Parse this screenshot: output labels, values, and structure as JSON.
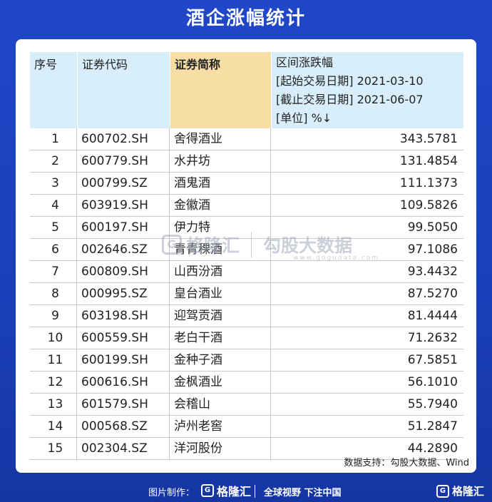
{
  "title": "酒企涨幅统计",
  "table": {
    "headers": {
      "index": "序号",
      "code": "证券代码",
      "name": "证券简称",
      "change_line1": "区间涨跌幅",
      "change_line2": "[起始交易日期] 2021-03-10",
      "change_line3": "[截止交易日期] 2021-06-07",
      "change_line4": "[单位] %↓"
    },
    "rows": [
      {
        "idx": "1",
        "code": "600702.SH",
        "name": "舍得酒业",
        "value": "343.5781"
      },
      {
        "idx": "2",
        "code": "600779.SH",
        "name": "水井坊",
        "value": "131.4854"
      },
      {
        "idx": "3",
        "code": "000799.SZ",
        "name": "酒鬼酒",
        "value": "111.1373"
      },
      {
        "idx": "4",
        "code": "603919.SH",
        "name": "金徽酒",
        "value": "109.5826"
      },
      {
        "idx": "5",
        "code": "600197.SH",
        "name": "伊力特",
        "value": "99.5050"
      },
      {
        "idx": "6",
        "code": "002646.SZ",
        "name": "青青稞酒",
        "value": "97.1086"
      },
      {
        "idx": "7",
        "code": "600809.SH",
        "name": "山西汾酒",
        "value": "93.4432"
      },
      {
        "idx": "8",
        "code": "000995.SZ",
        "name": "皇台酒业",
        "value": "87.5270"
      },
      {
        "idx": "9",
        "code": "603198.SH",
        "name": "迎驾贡酒",
        "value": "81.4444"
      },
      {
        "idx": "10",
        "code": "600559.SH",
        "name": "老白干酒",
        "value": "71.2632"
      },
      {
        "idx": "11",
        "code": "600199.SH",
        "name": "金种子酒",
        "value": "67.5851"
      },
      {
        "idx": "12",
        "code": "600616.SH",
        "name": "金枫酒业",
        "value": "56.1010"
      },
      {
        "idx": "13",
        "code": "601579.SH",
        "name": "会稽山",
        "value": "55.7940"
      },
      {
        "idx": "14",
        "code": "000568.SZ",
        "name": "泸州老窖",
        "value": "51.2847"
      },
      {
        "idx": "15",
        "code": "002304.SZ",
        "name": "洋河股份",
        "value": "44.2890"
      }
    ]
  },
  "watermark": {
    "brand": "格隆汇",
    "divider_text": "勾股大数据",
    "url": "www.gogudata.com"
  },
  "source": "数据支持：勾股大数据、Wind",
  "footer": {
    "made_by_label": "图片制作：",
    "logo_text": "格隆汇",
    "slogan": "全球视野 下注中国",
    "brand_right": "格隆汇"
  },
  "colors": {
    "background": "#1f47c8",
    "header": "#d9eefb",
    "name_header": "#f7dea4"
  }
}
